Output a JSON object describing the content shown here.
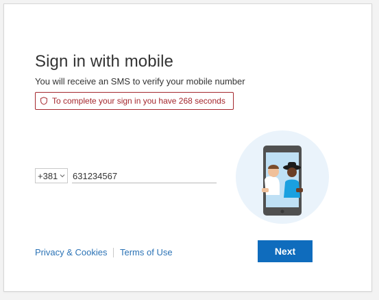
{
  "page": {
    "title": "Sign in with mobile",
    "subtitle": "You will receive an SMS to verify your mobile number"
  },
  "alert": {
    "message": "To complete your sign in you have 268 seconds",
    "icon": "shield-icon",
    "color": "#a4262c"
  },
  "phone": {
    "country_code": "+381",
    "number": "631234567"
  },
  "footer": {
    "privacy_label": "Privacy & Cookies",
    "terms_label": "Terms of Use"
  },
  "actions": {
    "next_label": "Next",
    "accent": "#0f6cbd"
  }
}
